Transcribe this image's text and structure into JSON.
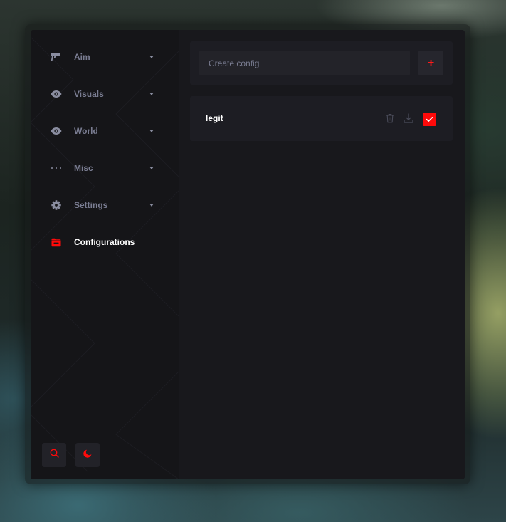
{
  "sidebar": {
    "items": [
      {
        "label": "Aim",
        "icon": "gun-icon",
        "has_dropdown": true
      },
      {
        "label": "Visuals",
        "icon": "eye-icon",
        "has_dropdown": true
      },
      {
        "label": "World",
        "icon": "eye-icon",
        "has_dropdown": true
      },
      {
        "label": "Misc",
        "icon": "dots-icon",
        "has_dropdown": true
      },
      {
        "label": "Settings",
        "icon": "gear-icon",
        "has_dropdown": true
      },
      {
        "label": "Configurations",
        "icon": "folder-icon",
        "has_dropdown": false,
        "active": true
      }
    ],
    "bottom_buttons": [
      {
        "icon": "search-icon"
      },
      {
        "icon": "moon-icon"
      }
    ]
  },
  "main": {
    "create": {
      "placeholder": "Create config",
      "value": "",
      "add_label": "+"
    },
    "configs": [
      {
        "name": "legit",
        "actions": [
          "trash-icon",
          "download-icon",
          "check-icon"
        ],
        "selected": true
      }
    ]
  },
  "colors": {
    "accent": "#ff0a0a",
    "text_muted": "#7a7d92",
    "text_active": "#ffffff",
    "panel": "#1d1d23",
    "sidebar": "#151518",
    "background": "#18181c"
  }
}
